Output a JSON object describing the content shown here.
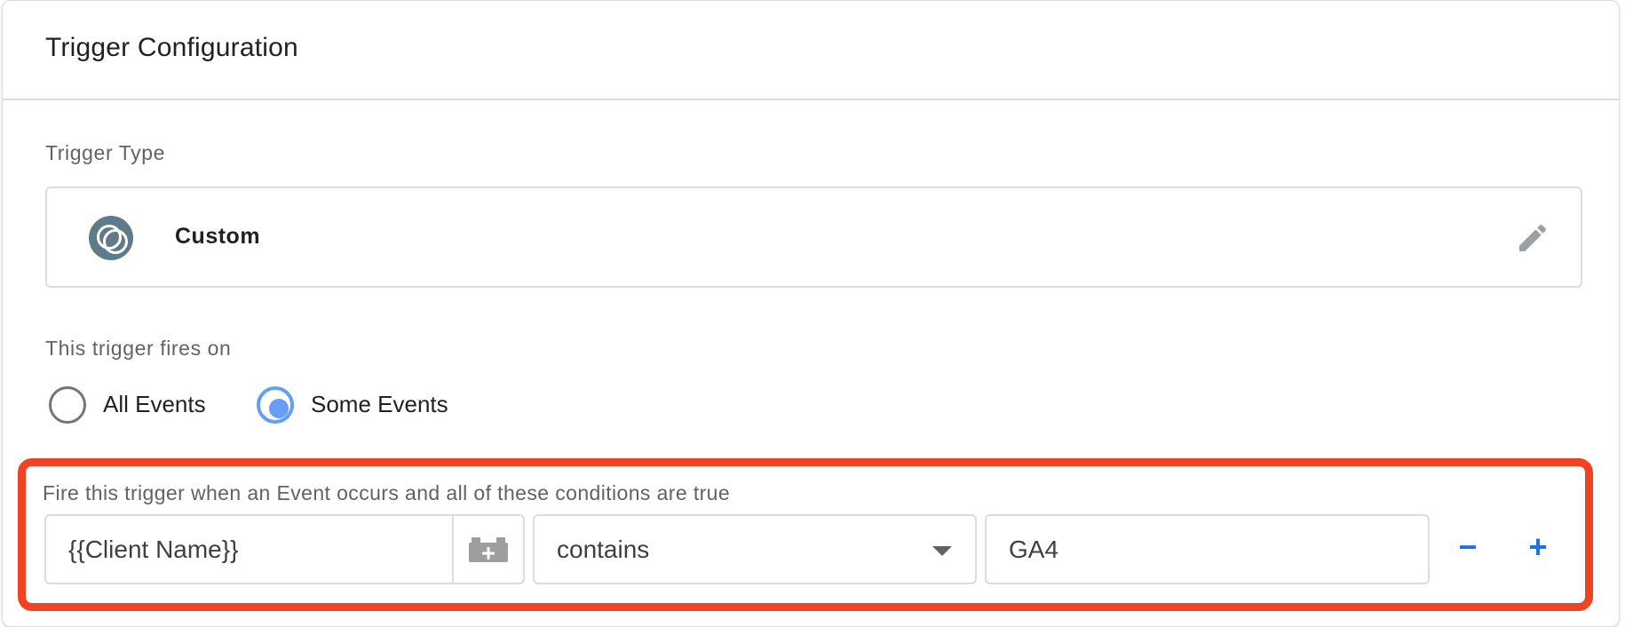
{
  "card": {
    "title": "Trigger Configuration"
  },
  "trigger_type": {
    "label": "Trigger Type",
    "name": "Custom",
    "icon": "custom-event-icon",
    "edit_icon": "pencil-icon"
  },
  "fires_on": {
    "label": "This trigger fires on",
    "options": [
      {
        "label": "All Events",
        "checked": false
      },
      {
        "label": "Some Events",
        "checked": true
      }
    ]
  },
  "condition": {
    "label": "Fire this trigger when an Event occurs and all of these conditions are true",
    "variable": "{{Client Name}}",
    "variable_icon": "variable-block-plus-icon",
    "operator": "contains",
    "value": "GA4",
    "remove_label": "−",
    "add_label": "+"
  },
  "colors": {
    "highlight_border": "#ee4423",
    "accent_blue": "#1a73e8",
    "radio_blue": "#669df6",
    "icon_bg": "#5f7b8a"
  }
}
